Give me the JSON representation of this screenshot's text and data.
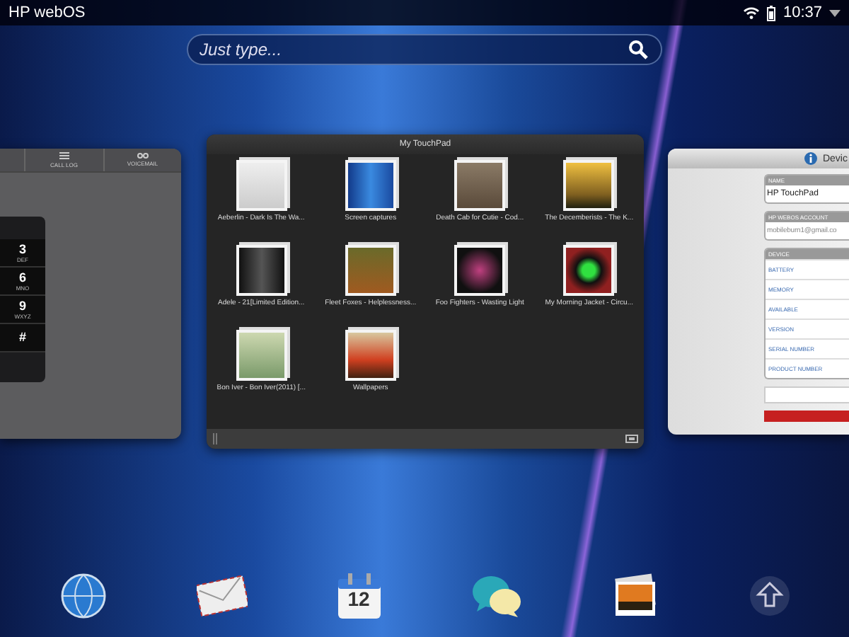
{
  "status_bar": {
    "title": "HP webOS",
    "time": "10:37"
  },
  "search": {
    "placeholder": "Just type..."
  },
  "phone_card": {
    "tabs": [
      {
        "label": "CALL LOG"
      },
      {
        "label": "VOICEMAIL"
      }
    ],
    "keys": [
      {
        "digit": "3",
        "letters": "DEF"
      },
      {
        "digit": "6",
        "letters": "MNO"
      },
      {
        "digit": "9",
        "letters": "WXYZ"
      },
      {
        "digit": "#"
      }
    ]
  },
  "photos_card": {
    "title": "My TouchPad",
    "albums": [
      {
        "label": "Aeberlin - Dark Is The Wa..."
      },
      {
        "label": "Screen captures"
      },
      {
        "label": "Death Cab for Cutie - Cod..."
      },
      {
        "label": "The Decemberists - The K..."
      },
      {
        "label": "Adele - 21[Limited Edition..."
      },
      {
        "label": "Fleet Foxes - Helplessness..."
      },
      {
        "label": "Foo Fighters - Wasting Light"
      },
      {
        "label": "My Morning Jacket - Circu..."
      },
      {
        "label": "Bon Iver - Bon Iver(2011) [..."
      },
      {
        "label": "Wallpapers"
      }
    ]
  },
  "device_card": {
    "title": "Devic",
    "name_label": "NAME",
    "name": "HP TouchPad",
    "account_label": "HP WEBOS ACCOUNT",
    "account": "mobileburn1@gmail.co",
    "device_label": "DEVICE",
    "rows": [
      "BATTERY",
      "MEMORY",
      "AVAILABLE",
      "VERSION",
      "SERIAL NUMBER",
      "PRODUCT NUMBER"
    ]
  },
  "dock": {
    "items": [
      {
        "kind": "browser"
      },
      {
        "kind": "email"
      },
      {
        "kind": "calendar",
        "text": "12"
      },
      {
        "kind": "messaging"
      },
      {
        "kind": "photos"
      },
      {
        "kind": "launcher"
      }
    ]
  }
}
